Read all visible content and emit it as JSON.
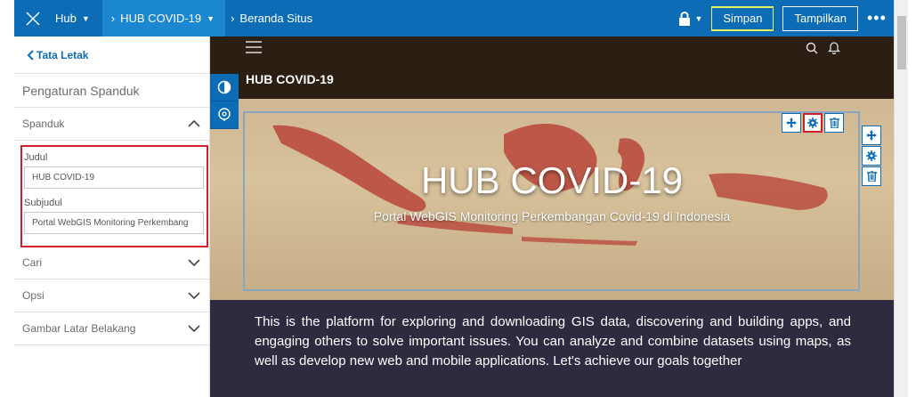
{
  "topbar": {
    "close_icon": "x-icon",
    "hub_label": "Hub",
    "site_label": "HUB COVID-19",
    "breadcrumb_label": "Beranda Situs",
    "save_label": "Simpan",
    "view_label": "Tampilkan",
    "more_label": "•••"
  },
  "left": {
    "back_label": "Tata Letak",
    "title": "Pengaturan Spanduk",
    "section_banner": "Spanduk",
    "title_label": "Judul",
    "title_value": "HUB COVID-19",
    "subtitle_label": "Subjudul",
    "subtitle_value": "Portal WebGIS Monitoring Perkembang",
    "section_search": "Cari",
    "section_options": "Opsi",
    "section_bg": "Gambar Latar Belakang"
  },
  "main": {
    "header_title": "HUB COVID-19",
    "banner_title": "HUB COVID-19",
    "banner_subtitle": "Portal WebGIS Monitoring Perkembangan Covid-19 di Indonesia",
    "body_text": "This is the platform for exploring and downloading GIS data, discovering and building apps, and engaging others to solve important issues. You can analyze and combine datasets using maps, as well as develop new web and mobile applications. Let's achieve our goals together"
  },
  "colors": {
    "brand_blue": "#0d6cb6",
    "active_tab": "#1b87d1",
    "highlight_red": "#d0202b",
    "map_red": "#b8453a"
  }
}
